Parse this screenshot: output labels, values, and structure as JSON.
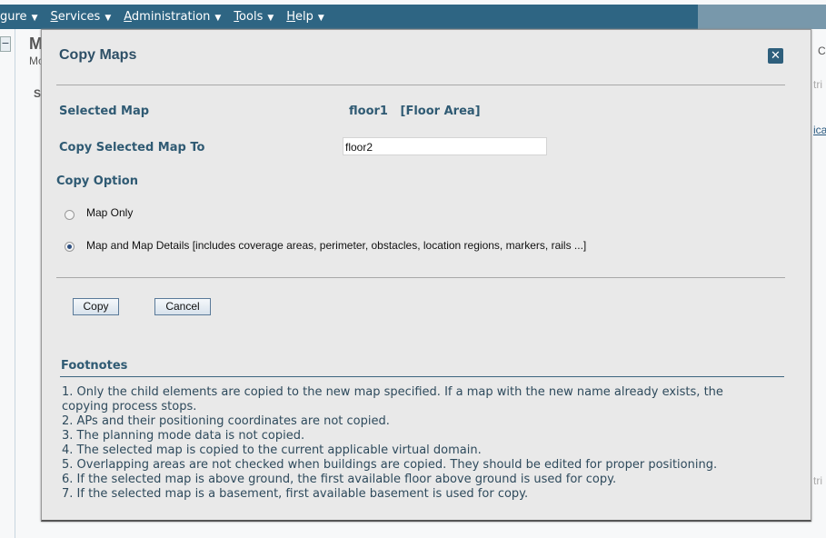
{
  "nav": {
    "items": [
      {
        "label": "gure"
      },
      {
        "label": "Services",
        "u": "S",
        "rest": "ervices"
      },
      {
        "label": "Administration",
        "u": "A",
        "rest": "dministration"
      },
      {
        "label": "Tools",
        "u": "T",
        "rest": "ools"
      },
      {
        "label": "Help",
        "u": "H",
        "rest": "elp"
      }
    ],
    "caret": "▼"
  },
  "background": {
    "m": "M",
    "mc": "Mc",
    "s": "S",
    "c": "C",
    "tri1": "tri",
    "ica": "ica",
    "tri2": "tri",
    "collapse": "−"
  },
  "dialog": {
    "title": "Copy Maps",
    "close": "✕",
    "selected_map_label": "Selected Map",
    "selected_map_value": "floor1   [Floor Area]",
    "copy_to_label": "Copy Selected Map To",
    "copy_to_value": "floor2",
    "copy_option_label": "Copy Option",
    "options": [
      {
        "label": "Map Only",
        "selected": false
      },
      {
        "label": "Map and Map Details [includes coverage areas, perimeter, obstacles, location regions, markers, rails ...]",
        "selected": true
      }
    ],
    "copy_button": "Copy",
    "cancel_button": "Cancel",
    "footnotes_title": "Footnotes",
    "footnotes": [
      "1. Only the child elements are copied to the new map specified. If a map with the new name already exists, the copying process stops.",
      "2. APs and their positioning coordinates are not copied.",
      "3. The planning mode data is not copied.",
      "4. The selected map is copied to the current applicable virtual domain.",
      "5. Overlapping areas are not checked when buildings are copied. They should be edited for proper positioning.",
      "6. If the selected map is above ground, the first available floor above ground is used for copy.",
      "7. If the selected map is a basement, first available basement is used for copy."
    ]
  },
  "colors": {
    "nav": "#2e6583",
    "accent": "#2f5a73",
    "dialog_bg": "#e9e9e9"
  }
}
